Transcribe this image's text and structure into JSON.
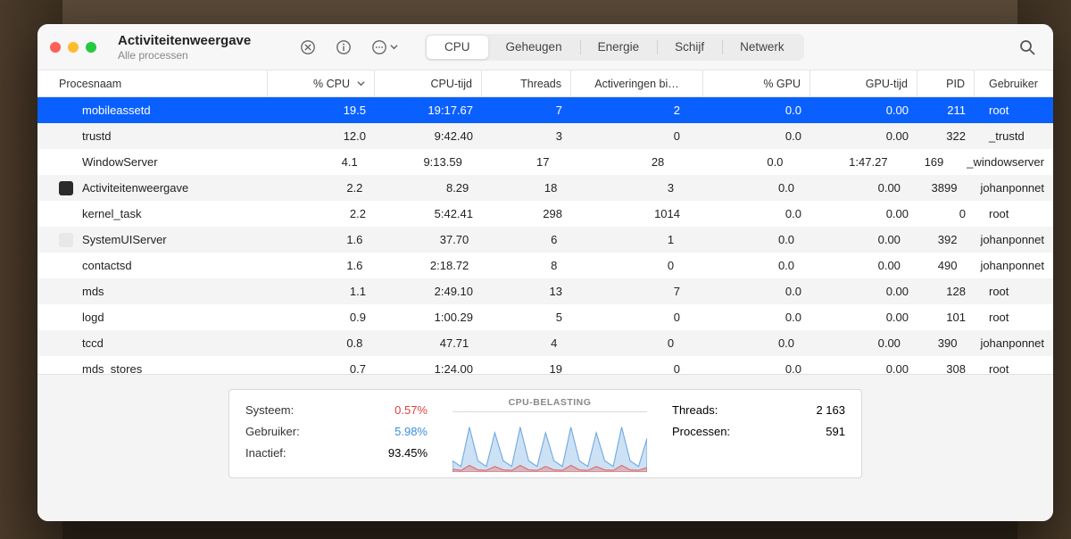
{
  "header": {
    "title": "Activiteitenweergave",
    "subtitle": "Alle processen"
  },
  "toolbar": {
    "tabs": [
      "CPU",
      "Geheugen",
      "Energie",
      "Schijf",
      "Netwerk"
    ],
    "active_tab_index": 0
  },
  "columns": {
    "name": "Procesnaam",
    "cpu": "% CPU",
    "cputime": "CPU-tijd",
    "threads": "Threads",
    "wakeups": "Activeringen bi…",
    "gpu": "% GPU",
    "gputime": "GPU-tijd",
    "pid": "PID",
    "user": "Gebruiker"
  },
  "rows": [
    {
      "icon": "blank",
      "name": "mobileassetd",
      "cpu": "19.5",
      "cputime": "19:17.67",
      "threads": "7",
      "wakeups": "2",
      "gpu": "0.0",
      "gputime": "0.00",
      "pid": "211",
      "user": "root",
      "selected": true
    },
    {
      "icon": "blank",
      "name": "trustd",
      "cpu": "12.0",
      "cputime": "9:42.40",
      "threads": "3",
      "wakeups": "0",
      "gpu": "0.0",
      "gputime": "0.00",
      "pid": "322",
      "user": "_trustd"
    },
    {
      "icon": "blank",
      "name": "WindowServer",
      "cpu": "4.1",
      "cputime": "9:13.59",
      "threads": "17",
      "wakeups": "28",
      "gpu": "0.0",
      "gputime": "1:47.27",
      "pid": "169",
      "user": "_windowserver"
    },
    {
      "icon": "dark",
      "name": "Activiteitenweergave",
      "cpu": "2.2",
      "cputime": "8.29",
      "threads": "18",
      "wakeups": "3",
      "gpu": "0.0",
      "gputime": "0.00",
      "pid": "3899",
      "user": "johanponnet"
    },
    {
      "icon": "blank",
      "name": "kernel_task",
      "cpu": "2.2",
      "cputime": "5:42.41",
      "threads": "298",
      "wakeups": "1014",
      "gpu": "0.0",
      "gputime": "0.00",
      "pid": "0",
      "user": "root"
    },
    {
      "icon": "light",
      "name": "SystemUIServer",
      "cpu": "1.6",
      "cputime": "37.70",
      "threads": "6",
      "wakeups": "1",
      "gpu": "0.0",
      "gputime": "0.00",
      "pid": "392",
      "user": "johanponnet"
    },
    {
      "icon": "blank",
      "name": "contactsd",
      "cpu": "1.6",
      "cputime": "2:18.72",
      "threads": "8",
      "wakeups": "0",
      "gpu": "0.0",
      "gputime": "0.00",
      "pid": "490",
      "user": "johanponnet"
    },
    {
      "icon": "blank",
      "name": "mds",
      "cpu": "1.1",
      "cputime": "2:49.10",
      "threads": "13",
      "wakeups": "7",
      "gpu": "0.0",
      "gputime": "0.00",
      "pid": "128",
      "user": "root"
    },
    {
      "icon": "blank",
      "name": "logd",
      "cpu": "0.9",
      "cputime": "1:00.29",
      "threads": "5",
      "wakeups": "0",
      "gpu": "0.0",
      "gputime": "0.00",
      "pid": "101",
      "user": "root"
    },
    {
      "icon": "blank",
      "name": "tccd",
      "cpu": "0.8",
      "cputime": "47.71",
      "threads": "4",
      "wakeups": "0",
      "gpu": "0.0",
      "gputime": "0.00",
      "pid": "390",
      "user": "johanponnet"
    },
    {
      "icon": "blank",
      "name": "mds_stores",
      "cpu": "0.7",
      "cputime": "1:24.00",
      "threads": "19",
      "wakeups": "0",
      "gpu": "0.0",
      "gputime": "0.00",
      "pid": "308",
      "user": "root"
    }
  ],
  "footer": {
    "left": {
      "system_label": "Systeem:",
      "system_value": "0.57%",
      "user_label": "Gebruiker:",
      "user_value": "5.98%",
      "idle_label": "Inactief:",
      "idle_value": "93.45%"
    },
    "chart_label": "CPU-BELASTING",
    "right": {
      "threads_label": "Threads:",
      "threads_value": "2 163",
      "proc_label": "Processen:",
      "proc_value": "591"
    }
  },
  "chart_data": {
    "type": "area",
    "series": [
      {
        "name": "user",
        "color": "#6fa8e0",
        "values": [
          2,
          1,
          8,
          2,
          1,
          7,
          2,
          1,
          8,
          2,
          1,
          7,
          2,
          1,
          8,
          2,
          1,
          7,
          2,
          1,
          8,
          2,
          1,
          6
        ]
      },
      {
        "name": "system",
        "color": "#e06a65",
        "values": [
          0.5,
          0.3,
          1.2,
          0.4,
          0.3,
          1.0,
          0.4,
          0.3,
          1.2,
          0.4,
          0.3,
          1.0,
          0.4,
          0.3,
          1.2,
          0.4,
          0.3,
          1.0,
          0.4,
          0.3,
          1.2,
          0.4,
          0.3,
          0.8
        ]
      }
    ],
    "ylim": [
      0,
      10
    ]
  }
}
